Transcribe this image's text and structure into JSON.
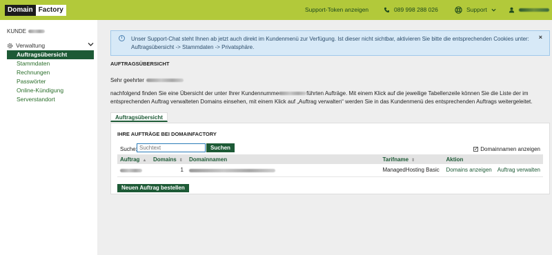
{
  "brand": {
    "word1": "Domain",
    "word2": "Factory"
  },
  "header": {
    "support_token": "Support-Token anzeigen",
    "phone": "089 998 288 026",
    "support_menu": "Support"
  },
  "sidebar": {
    "kunde_label": "KUNDE",
    "section": "Verwaltung",
    "items": [
      {
        "label": "Auftragsübersicht",
        "active": true
      },
      {
        "label": "Stammdaten"
      },
      {
        "label": "Rechnungen"
      },
      {
        "label": "Passwörter"
      },
      {
        "label": "Online-Kündigung"
      },
      {
        "label": "Serverstandort"
      }
    ]
  },
  "notice": {
    "text": "Unser Support-Chat steht Ihnen ab jetzt auch direkt im Kundenmenü zur Verfügung. Ist dieser nicht sichtbar, aktivieren Sie bitte die entsprechenden Cookies unter: Auftragsübersicht -> Stammdaten -> Privatsphäre.",
    "close": "×"
  },
  "page": {
    "title": "AUFTRAGSÜBERSICHT",
    "greeting": "Sehr geehrter",
    "intro_part1": "nachfolgend finden Sie eine Übersicht der unter Ihrer Kundennumme",
    "intro_part2": "führten Aufträge. Mit einem Klick auf die jeweilige Tabellenzeile können Sie die Liste der im entsprechenden Auftrag verwalteten Domains einsehen, mit einem Klick auf „Auftrag verwalten“ werden Sie in das Kundenmenü des entsprechenden Auftrags weitergeleitet.",
    "tab": "Auftragsübersicht",
    "panel_title": "IHRE AUFTRÄGE BEI DOMAINFACTORY"
  },
  "search": {
    "label": "Suche:",
    "placeholder": "Suchtext",
    "button": "Suchen",
    "checkbox_label": "Domainnamen anzeigen",
    "checkbox_checked": true
  },
  "table": {
    "headers": {
      "auftrag": "Auftrag",
      "domains": "Domains",
      "domainnamen": "Domainnamen",
      "tarifname": "Tarifname",
      "aktion": "Aktion"
    },
    "rows": [
      {
        "domains": "1",
        "tarifname": "ManagedHosting Basic",
        "action1": "Domains anzeigen",
        "action2": "Auftrag verwalten"
      }
    ]
  },
  "new_order_button": "Neuen Auftrag bestellen",
  "colors": {
    "brand_green": "#b2c93a",
    "dark_green": "#1d5a36",
    "notice_bg": "#d7e9f7"
  }
}
